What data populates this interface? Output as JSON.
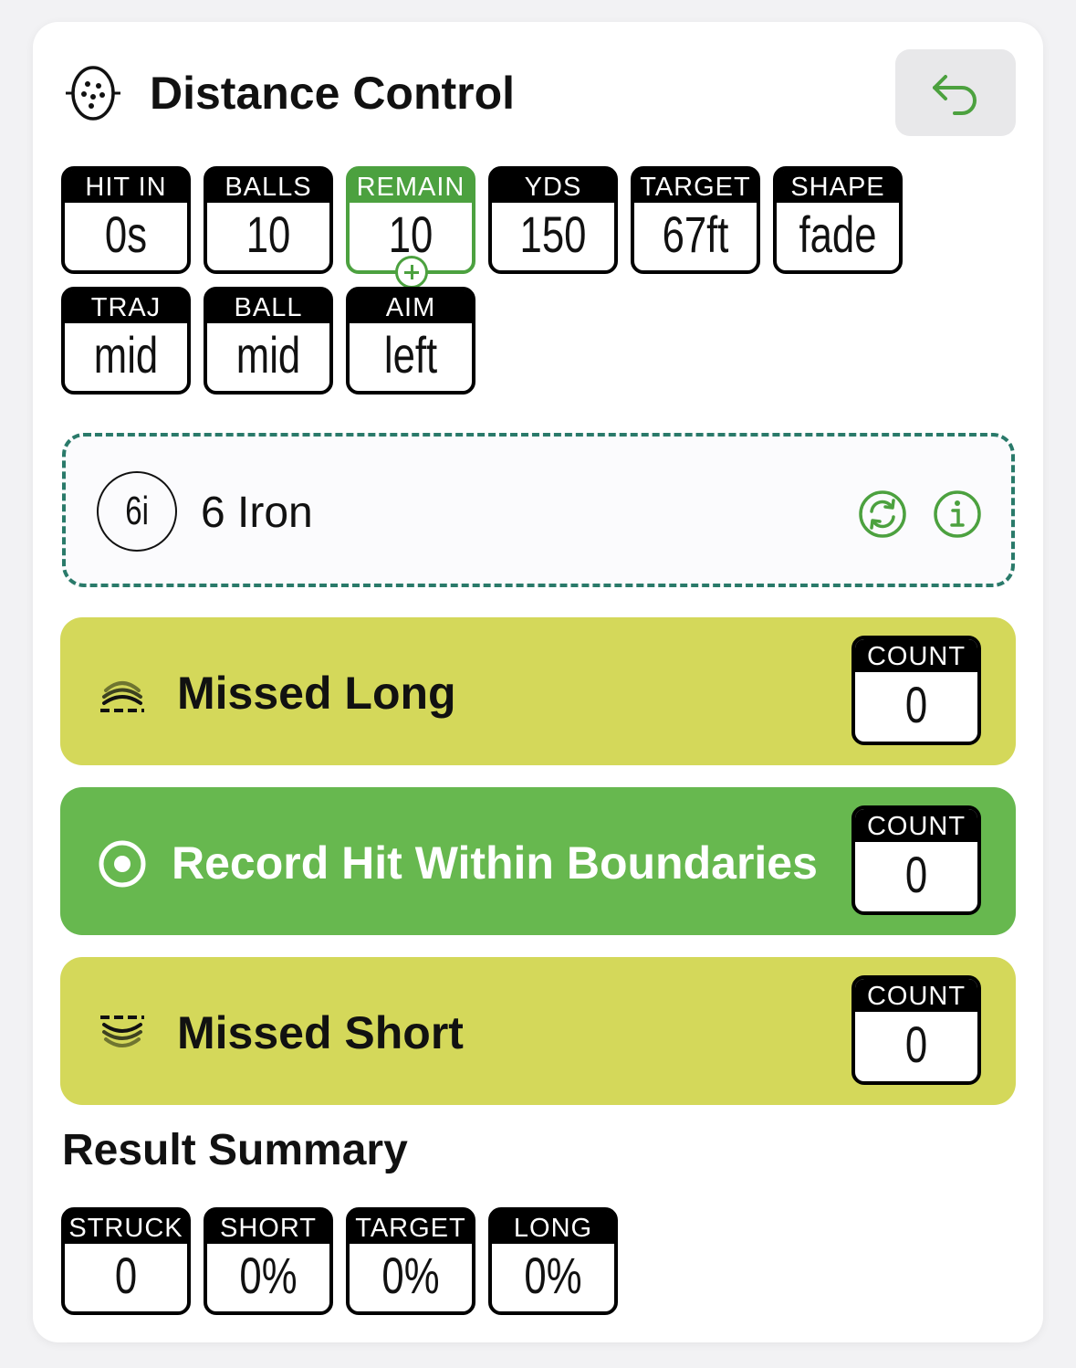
{
  "header": {
    "title": "Distance Control",
    "back_icon": "undo-arrow-icon"
  },
  "stats": [
    {
      "label": "HIT IN",
      "value": "0s"
    },
    {
      "label": "BALLS",
      "value": "10"
    },
    {
      "label": "REMAIN",
      "value": "10"
    },
    {
      "label": "YDS",
      "value": "150"
    },
    {
      "label": "TARGET",
      "value": "67ft"
    },
    {
      "label": "SHAPE",
      "value": "fade"
    },
    {
      "label": "TRAJ",
      "value": "mid"
    },
    {
      "label": "BALL",
      "value": "mid"
    },
    {
      "label": "AIM",
      "value": "left"
    }
  ],
  "club": {
    "badge": "6i",
    "name": "6 Iron"
  },
  "results": [
    {
      "label": "Missed Long",
      "count_label": "COUNT",
      "count": "0"
    },
    {
      "label": "Record Hit Within Boundaries",
      "count_label": "COUNT",
      "count": "0"
    },
    {
      "label": "Missed Short",
      "count_label": "COUNT",
      "count": "0"
    }
  ],
  "summary": {
    "title": "Result Summary",
    "items": [
      {
        "label": "STRUCK",
        "value": "0"
      },
      {
        "label": "SHORT",
        "value": "0%"
      },
      {
        "label": "TARGET",
        "value": "0%"
      },
      {
        "label": "LONG",
        "value": "0%"
      }
    ]
  },
  "colors": {
    "accent_green": "#4ca13f",
    "miss_yellow": "#d4d85a",
    "hit_green": "#67b84f",
    "dash_teal": "#2a7a6a"
  }
}
